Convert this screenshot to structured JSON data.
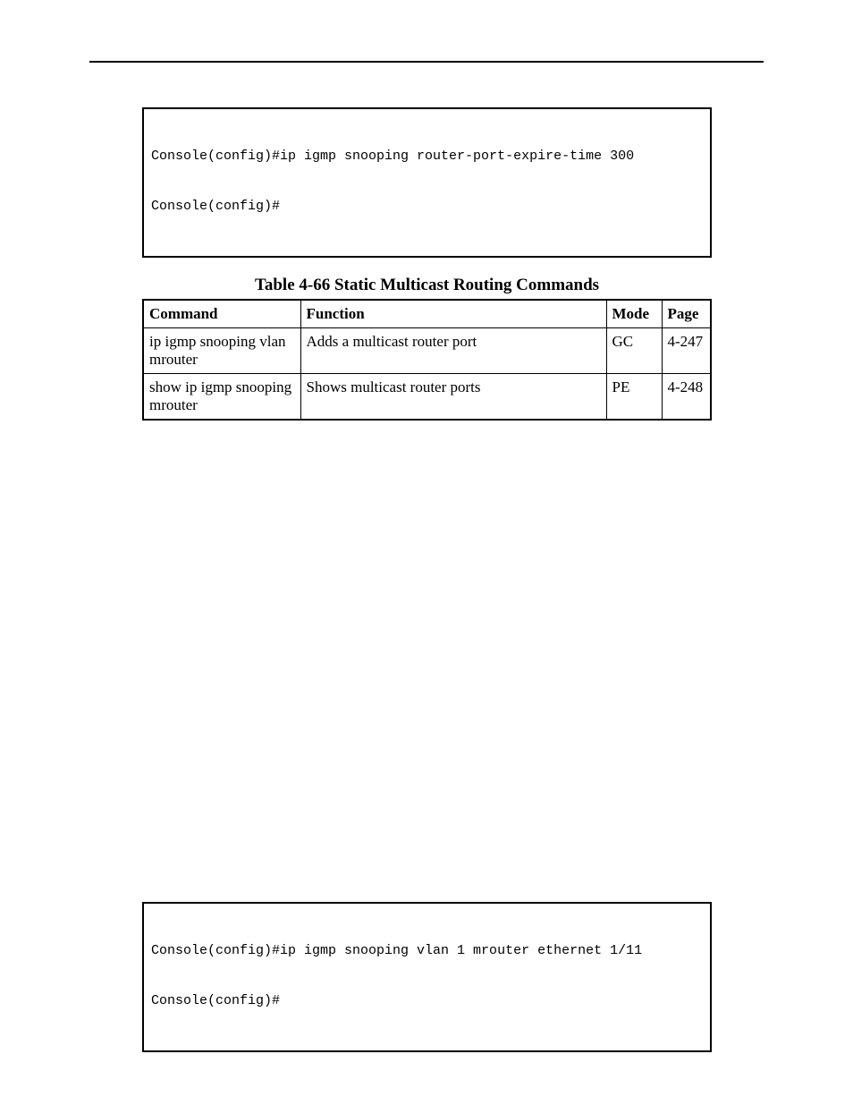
{
  "code1": {
    "line1": "Console(config)#ip igmp snooping router-port-expire-time 300",
    "line2": "Console(config)#"
  },
  "table": {
    "caption": "Table 4-66 Static Multicast Routing Commands",
    "headers": {
      "command": "Command",
      "function": "Function",
      "mode": "Mode",
      "page": "Page"
    },
    "rows": [
      {
        "command": "ip igmp snooping vlan mrouter",
        "function": "Adds a multicast router port",
        "mode": "GC",
        "page": "4-247"
      },
      {
        "command": "show ip igmp snooping mrouter",
        "function": "Shows multicast router ports",
        "mode": "PE",
        "page": "4-248"
      }
    ]
  },
  "code2": {
    "line1": "Console(config)#ip igmp snooping vlan 1 mrouter ethernet 1/11",
    "line2": "Console(config)#"
  }
}
